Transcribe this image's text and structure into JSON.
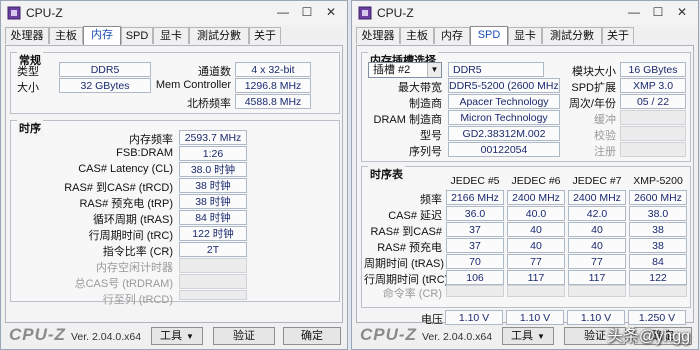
{
  "left": {
    "title": "CPU-Z",
    "tabs": [
      "处理器",
      "主板",
      "内存",
      "SPD",
      "显卡",
      "測試分數",
      "关于"
    ],
    "general": {
      "title": "常规",
      "type_label": "类型",
      "type_value": "DDR5",
      "size_label": "大小",
      "size_value": "32 GBytes",
      "channels_label": "通道数",
      "channels_value": "4 x 32-bit",
      "memctrl_label": "Mem Controller",
      "memctrl_value": "1296.8 MHz",
      "nb_label": "北桥频率",
      "nb_value": "4588.8 MHz"
    },
    "timings": {
      "title": "时序",
      "rows": [
        {
          "label": "内存频率",
          "value": "2593.7 MHz"
        },
        {
          "label": "FSB:DRAM",
          "value": "1:26"
        },
        {
          "label": "CAS# Latency (CL)",
          "value": "38.0 时钟"
        },
        {
          "label": "RAS# 到CAS# (tRCD)",
          "value": "38 时钟"
        },
        {
          "label": "RAS# 预充电 (tRP)",
          "value": "38 时钟"
        },
        {
          "label": "循环周期 (tRAS)",
          "value": "84 时钟"
        },
        {
          "label": "行周期时间 (tRC)",
          "value": "122 时钟"
        },
        {
          "label": "指令比率 (CR)",
          "value": "2T"
        },
        {
          "label": "内存空闲计时器",
          "value": ""
        },
        {
          "label": "总CAS号 (tRDRAM)",
          "value": ""
        },
        {
          "label": "行至列 (tRCD)",
          "value": ""
        }
      ]
    },
    "footer": {
      "logo": "CPU-Z",
      "version": "Ver. 2.04.0.x64",
      "tools": "工具",
      "validate": "验证",
      "ok": "确定"
    }
  },
  "right": {
    "title": "CPU-Z",
    "tabs": [
      "处理器",
      "主板",
      "内存",
      "SPD",
      "显卡",
      "測試分數",
      "关于"
    ],
    "slot": {
      "title": "内存插槽选择",
      "selected": "插槽 #2",
      "type_value": "DDR5",
      "module_size_label": "模块大小",
      "module_size_value": "16 GBytes",
      "max_bw_label": "最大带宽",
      "max_bw_value": "DDR5-5200 (2600 MHz)",
      "spd_ext_label": "SPD扩展",
      "spd_ext_value": "XMP 3.0",
      "manufacturer_label": "制造商",
      "manufacturer_value": "Apacer Technology",
      "week_year_label": "周次/年份",
      "week_year_value": "05 / 22",
      "dram_mfr_label": "DRAM 制造商",
      "dram_mfr_value": "Micron Technology",
      "buffered_label": "缓冲",
      "part_label": "型号",
      "part_value": "GD2.38312M.002",
      "correction_label": "校验",
      "serial_label": "序列号",
      "serial_value": "00122054",
      "registered_label": "注册"
    },
    "timing_table": {
      "title": "时序表",
      "headers": [
        "JEDEC #5",
        "JEDEC #6",
        "JEDEC #7",
        "XMP-5200"
      ],
      "rows": [
        {
          "label": "频率",
          "values": [
            "2166 MHz",
            "2400 MHz",
            "2400 MHz",
            "2600 MHz"
          ]
        },
        {
          "label": "CAS# 延迟",
          "values": [
            "36.0",
            "40.0",
            "42.0",
            "38.0"
          ]
        },
        {
          "label": "RAS# 到CAS#",
          "values": [
            "37",
            "40",
            "40",
            "38"
          ]
        },
        {
          "label": "RAS# 预充电",
          "values": [
            "37",
            "40",
            "40",
            "38"
          ]
        },
        {
          "label": "周期时间 (tRAS)",
          "values": [
            "70",
            "77",
            "77",
            "84"
          ]
        },
        {
          "label": "行周期时间 (tRC)",
          "values": [
            "106",
            "117",
            "117",
            "122"
          ]
        },
        {
          "label": "命令率 (CR)",
          "values": [
            "",
            "",
            "",
            ""
          ]
        },
        {
          "label": "电压",
          "values": [
            "1.10 V",
            "1.10 V",
            "1.10 V",
            "1.250 V"
          ]
        }
      ]
    },
    "footer": {
      "logo": "CPU-Z",
      "version": "Ver. 2.04.0.x64",
      "tools": "工具",
      "validate": "验证",
      "ok": "确定"
    }
  },
  "watermark": "头条@yhgg",
  "colors": {
    "value_text": "#1a2a6e",
    "active_tab_text": "#1c4fb5",
    "disabled_text": "#9a9a9a"
  }
}
